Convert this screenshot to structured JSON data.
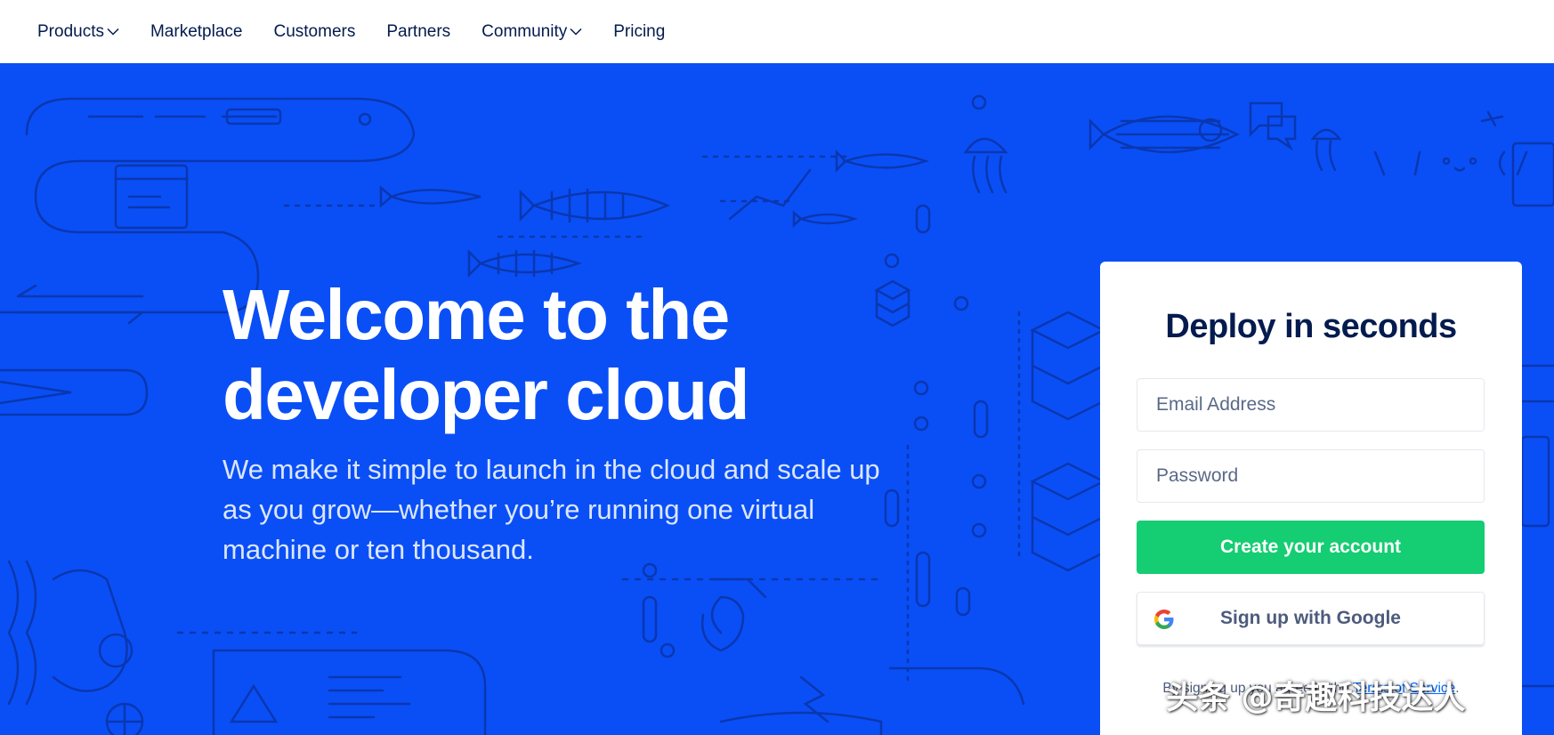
{
  "nav": {
    "items": [
      {
        "label": "Products",
        "dropdown": true,
        "icon": "chevron-down-icon"
      },
      {
        "label": "Marketplace",
        "dropdown": false
      },
      {
        "label": "Customers",
        "dropdown": false
      },
      {
        "label": "Partners",
        "dropdown": false
      },
      {
        "label": "Community",
        "dropdown": true,
        "icon": "chevron-down-icon"
      },
      {
        "label": "Pricing",
        "dropdown": false
      }
    ]
  },
  "hero": {
    "title_line1": "Welcome to the",
    "title_line2": "developer cloud",
    "subtitle": "We make it simple to launch in the cloud and scale up as you grow—whether you’re running one virtual machine or ten thousand."
  },
  "signup": {
    "title": "Deploy in seconds",
    "email_placeholder": "Email Address",
    "password_placeholder": "Password",
    "create_label": "Create your account",
    "google_label": "Sign up with Google",
    "google_icon": "google-g-icon",
    "terms_prefix": "By signing up you agree to the ",
    "terms_link": "Terms of Service",
    "terms_suffix": "."
  },
  "watermark": "头条 @奇趣科技达人",
  "colors": {
    "hero_bg": "#0a4ff5",
    "accent_green": "#15cd72",
    "navy_text": "#031b4e",
    "link_blue": "#0069ff"
  }
}
